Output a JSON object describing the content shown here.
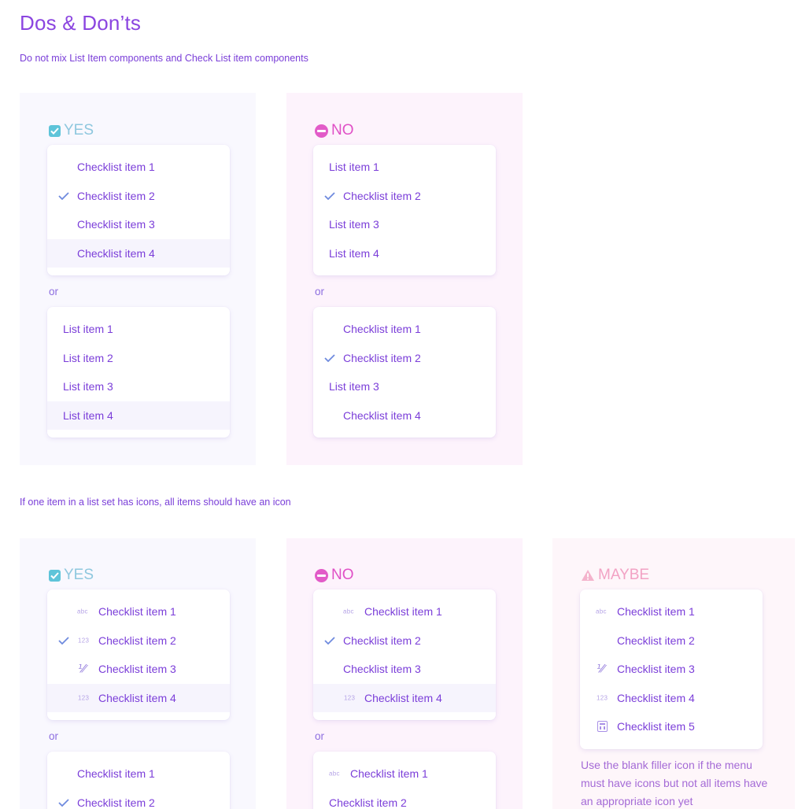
{
  "title": "Dos & Don’ts",
  "rule1": "Do not mix List Item components and Check List item components",
  "rule2": "If one item in a list set has icons, all items should have an icon",
  "labels": {
    "yes": "YES",
    "no": "NO",
    "maybe": "MAYBE",
    "or": "or"
  },
  "s1": {
    "yes_a": [
      "Checklist item 1",
      "Checklist item 2",
      "Checklist item 3",
      "Checklist item 4"
    ],
    "yes_b": [
      "List item 1",
      "List item 2",
      "List item 3",
      "List item 4"
    ],
    "no_a": [
      "List item 1",
      "Checklist item 2",
      "List item 3",
      "List item 4"
    ],
    "no_b": [
      "Checklist item 1",
      "Checklist item 2",
      "List item 3",
      "Checklist item 4"
    ]
  },
  "s2": {
    "yes_a": [
      "Checklist item 1",
      "Checklist item 2",
      "Checklist item 3",
      "Checklist item 4"
    ],
    "yes_b": [
      "Checklist item 1",
      "Checklist item 2"
    ],
    "no_a": [
      "Checklist item 1",
      "Checklist item 2",
      "Checklist item 3",
      "Checklist item 4"
    ],
    "no_b": [
      "Checklist item 1",
      "Checklist item 2"
    ],
    "maybe": [
      "Checklist item 1",
      "Checklist item 2",
      "Checklist item 3",
      "Checklist item 4",
      "Checklist item 5"
    ],
    "maybe_note": "Use the blank filler icon if the menu must have icons but not all items have an appropriate icon yet"
  },
  "icon_text": {
    "abc": "abc",
    "num": "123",
    "frac": "⅟⁄"
  },
  "icons": [
    "checkbox-checked-icon",
    "no-entry-icon",
    "warning-icon",
    "checkmark-icon",
    "abc-icon",
    "123-icon",
    "fraction-icon",
    "calculator-icon"
  ]
}
